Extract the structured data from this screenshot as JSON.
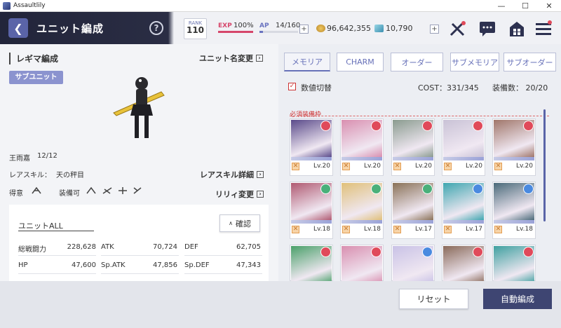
{
  "window": {
    "title": "Assaultlily",
    "minimize": "—",
    "maximize": "☐",
    "close": "✕"
  },
  "header": {
    "title": "ユニット編成",
    "help": "?",
    "rank_label": "RANK",
    "rank_value": "110",
    "exp_label": "EXP",
    "exp_value": "100%",
    "exp_progress": 1.0,
    "ap_label": "AP",
    "ap_value": "14/160",
    "ap_progress": 0.0875,
    "gold_value": "96,642,355",
    "gem_value": "10,790",
    "plus": "+",
    "colors": {
      "accent": "#5a64a8",
      "exp": "#d6466b",
      "ap": "#6a74c0"
    }
  },
  "left": {
    "section_title": "レギマ編成",
    "rename_link": "ユニット名変更",
    "sub_unit": "サブユニット",
    "character_name": "王雨嘉",
    "character_count": "12/12",
    "rare_skill_label": "レアスキル：",
    "rare_skill_value": "天の秤目",
    "rare_skill_link": "レアスキル詳細",
    "strength_label": "得意",
    "equip_label": "装備可",
    "lily_change": "リリィ変更",
    "stats": {
      "unit_label": "ユニットALL",
      "confirm": "確認",
      "rows": [
        [
          {
            "label": "総戦闘力",
            "value": "228,628"
          },
          {
            "label": "ATK",
            "value": "70,724"
          },
          {
            "label": "DEF",
            "value": "62,705"
          }
        ],
        [
          {
            "label": "HP",
            "value": "47,600"
          },
          {
            "label": "Sp.ATK",
            "value": "47,856"
          },
          {
            "label": "Sp.DEF",
            "value": "47,343"
          }
        ]
      ]
    }
  },
  "right": {
    "tabs": [
      "メモリア",
      "CHARM",
      "オーダー",
      "サブメモリア",
      "サブオーダー"
    ],
    "active_tab": 0,
    "numeric_toggle": "数値切替",
    "cost": "COST：331/345",
    "equip_count": "装備数： 20/20",
    "required_label": "必須装備枠",
    "cards": [
      {
        "lv": "Lv.20",
        "color": "#5a4a8a",
        "elem": "#e04a5a"
      },
      {
        "lv": "Lv.20",
        "color": "#d98fb0",
        "elem": "#e04a5a"
      },
      {
        "lv": "Lv.20",
        "color": "#8a9b8f",
        "elem": "#e04a5a"
      },
      {
        "lv": "Lv.20",
        "color": "#c9c2d6",
        "elem": "#e04a5a"
      },
      {
        "lv": "Lv.20",
        "color": "#a0766a",
        "elem": "#e04a5a"
      },
      {
        "lv": "Lv.18",
        "color": "#b05a72",
        "elem": "#4ab07a"
      },
      {
        "lv": "Lv.18",
        "color": "#e0c07a",
        "elem": "#4ab07a"
      },
      {
        "lv": "Lv.17",
        "color": "#8a7258",
        "elem": "#4ab07a"
      },
      {
        "lv": "Lv.17",
        "color": "#3fa6b0",
        "elem": "#4a8ae0"
      },
      {
        "lv": "Lv.18",
        "color": "#4a6a7a",
        "elem": "#4a8ae0"
      },
      {
        "lv": "",
        "color": "#4aa06a",
        "elem": "#e04a5a"
      },
      {
        "lv": "",
        "color": "#d98fb0",
        "elem": "#e04a5a"
      },
      {
        "lv": "",
        "color": "#c9c2e6",
        "elem": "#4a8ae0"
      },
      {
        "lv": "",
        "color": "#8a6a5a",
        "elem": "#e04a5a"
      },
      {
        "lv": "",
        "color": "#3fa0a0",
        "elem": "#e04a5a"
      }
    ]
  },
  "bottom": {
    "reset": "リセット",
    "auto": "自動編成"
  }
}
